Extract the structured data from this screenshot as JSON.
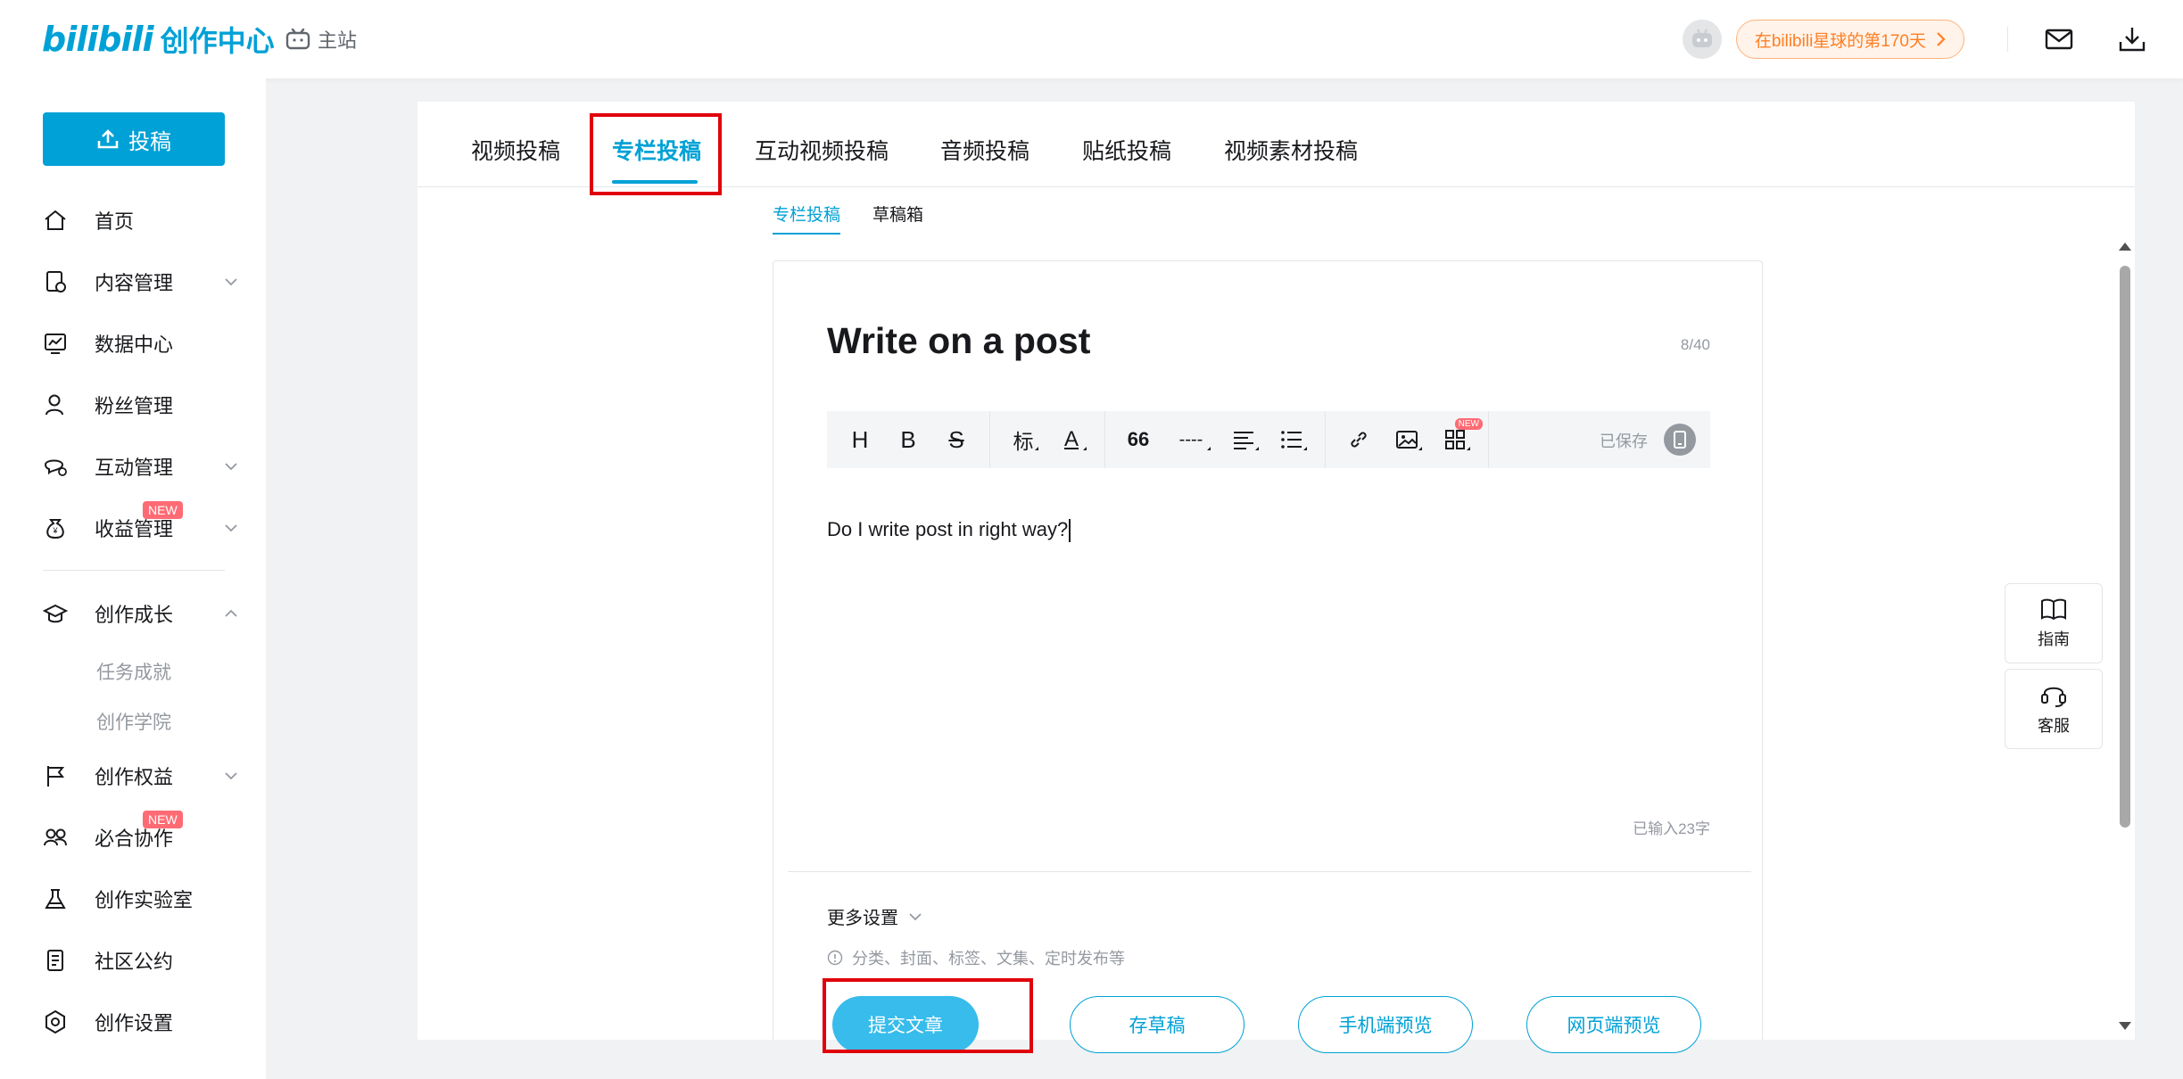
{
  "header": {
    "logo_brand": "bilibili",
    "logo_text": "创作中心",
    "main_site": "主站",
    "days_pill": "在bilibili星球的第170天"
  },
  "sidebar": {
    "post_button": "投稿",
    "items": [
      {
        "label": "首页"
      },
      {
        "label": "内容管理"
      },
      {
        "label": "数据中心"
      },
      {
        "label": "粉丝管理"
      },
      {
        "label": "互动管理"
      },
      {
        "label": "收益管理",
        "badge": "NEW"
      },
      {
        "label": "创作成长"
      },
      {
        "label": "任务成就"
      },
      {
        "label": "创作学院"
      },
      {
        "label": "创作权益"
      },
      {
        "label": "必合协作",
        "badge": "NEW"
      },
      {
        "label": "创作实验室"
      },
      {
        "label": "社区公约"
      },
      {
        "label": "创作设置"
      }
    ]
  },
  "tabs": [
    {
      "label": "视频投稿"
    },
    {
      "label": "专栏投稿",
      "active": true
    },
    {
      "label": "互动视频投稿"
    },
    {
      "label": "音频投稿"
    },
    {
      "label": "贴纸投稿"
    },
    {
      "label": "视频素材投稿"
    }
  ],
  "subtabs": [
    {
      "label": "专栏投稿",
      "active": true
    },
    {
      "label": "草稿箱"
    }
  ],
  "editor": {
    "title": "Write on a post",
    "title_count": "8/40",
    "toolbar": {
      "heading": "H",
      "bold": "B",
      "strike": "S",
      "label": "标",
      "color": "A",
      "quote": "66",
      "divider": "----",
      "saved": "已保存",
      "new_badge": "NEW"
    },
    "content": "Do I write post in right way?",
    "word_count": "已输入23字",
    "more_settings": "更多设置",
    "settings_hint": "分类、封面、标签、文集、定时发布等",
    "buttons": {
      "submit": "提交文章",
      "draft": "存草稿",
      "mobile_preview": "手机端预览",
      "web_preview": "网页端预览"
    }
  },
  "float": {
    "guide": "指南",
    "service": "客服"
  },
  "colors": {
    "accent": "#00a1d6",
    "primary_button": "#37bcec",
    "highlight_box": "#e0000b",
    "badge": "#ff6b74"
  }
}
